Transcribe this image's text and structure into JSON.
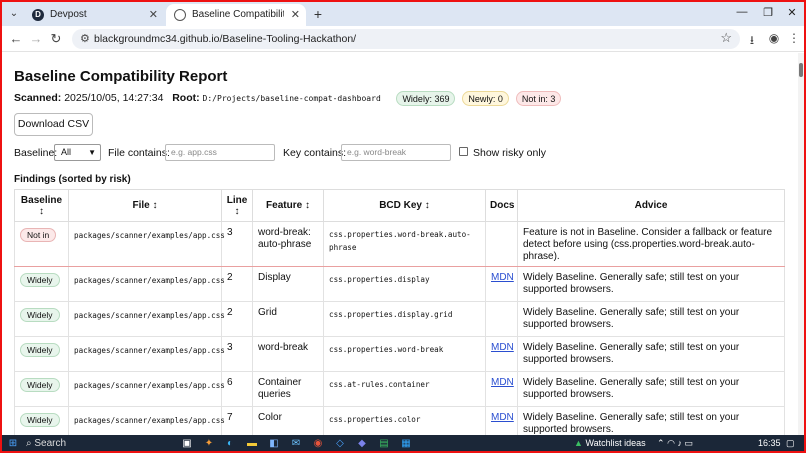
{
  "browser": {
    "tabs": [
      {
        "title": "Devpost",
        "favicon": "D"
      },
      {
        "title": "Baseline Compatibility Report"
      }
    ],
    "url": "blackgroundmc34.github.io/Baseline-Tooling-Hackathon/"
  },
  "report": {
    "title": "Baseline Compatibility Report",
    "scanned_label": "Scanned:",
    "scanned_value": "2025/10/05, 14:27:34",
    "root_label": "Root:",
    "root_value": "D:/Projects/baseline-compat-dashboard",
    "pills": {
      "widely": "Widely: 369",
      "newly": "Newly: 0",
      "notin": "Not in: 3"
    },
    "download_label": "Download CSV",
    "filters": {
      "baseline_label": "Baseline:",
      "baseline_value": "All",
      "file_label": "File contains:",
      "file_placeholder": "e.g. app.css",
      "key_label": "Key contains:",
      "key_placeholder": "e.g. word-break",
      "risky_label": "Show risky only"
    },
    "findings_title": "Findings (sorted by risk)",
    "columns": {
      "baseline": "Baseline",
      "file": "File",
      "line": "Line",
      "feature": "Feature",
      "key": "BCD Key",
      "docs": "Docs",
      "advice": "Advice",
      "sort_icon": "↕"
    },
    "rows": [
      {
        "baseline": "Not in",
        "file": "packages/scanner/examples/app.css",
        "line": "3",
        "feature": "word-break: auto-phrase",
        "key": "css.properties.word-break.auto-phrase",
        "docs": "",
        "advice": "Feature is not in Baseline. Consider a fallback or feature detect before using (css.properties.word-break.auto-phrase)."
      },
      {
        "baseline": "Widely",
        "file": "packages/scanner/examples/app.css",
        "line": "2",
        "feature": "Display",
        "key": "css.properties.display",
        "docs": "MDN",
        "advice": "Widely Baseline. Generally safe; still test on your supported browsers."
      },
      {
        "baseline": "Widely",
        "file": "packages/scanner/examples/app.css",
        "line": "2",
        "feature": "Grid",
        "key": "css.properties.display.grid",
        "docs": "",
        "advice": "Widely Baseline. Generally safe; still test on your supported browsers."
      },
      {
        "baseline": "Widely",
        "file": "packages/scanner/examples/app.css",
        "line": "3",
        "feature": "word-break",
        "key": "css.properties.word-break",
        "docs": "MDN",
        "advice": "Widely Baseline. Generally safe; still test on your supported browsers."
      },
      {
        "baseline": "Widely",
        "file": "packages/scanner/examples/app.css",
        "line": "6",
        "feature": "Container queries",
        "key": "css.at-rules.container",
        "docs": "MDN",
        "advice": "Widely Baseline. Generally safe; still test on your supported browsers."
      },
      {
        "baseline": "Widely",
        "file": "packages/scanner/examples/app.css",
        "line": "7",
        "feature": "Color",
        "key": "css.properties.color",
        "docs": "MDN",
        "advice": "Widely Baseline. Generally safe; still test on your supported browsers."
      }
    ]
  },
  "taskbar": {
    "search_label": "Search",
    "watchlist_label": "Watchlist ideas",
    "time": "16:35"
  },
  "colors": {
    "frame": "#ee1111",
    "link": "#2a4ed0",
    "taskbar": "#1b2738"
  }
}
